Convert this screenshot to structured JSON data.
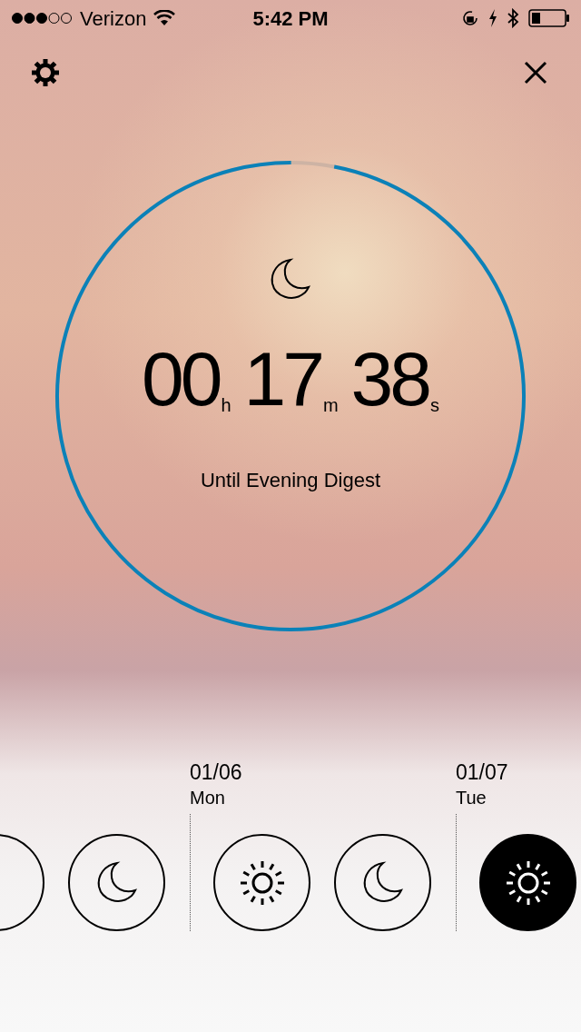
{
  "status_bar": {
    "carrier": "Verizon",
    "time": "5:42 PM"
  },
  "timer": {
    "level": 0.97,
    "countdown": [
      {
        "value": "00",
        "unit": "h"
      },
      {
        "value": "17",
        "unit": "m"
      },
      {
        "value": "38",
        "unit": "s"
      }
    ],
    "caption": "Until Evening Digest"
  },
  "days": [
    {
      "slots": [
        {
          "kind": "blank",
          "selected": false
        },
        {
          "kind": "moon",
          "selected": false
        }
      ]
    },
    {
      "date": "01/06",
      "weekday": "Mon",
      "slots": [
        {
          "kind": "sun",
          "selected": false
        },
        {
          "kind": "moon",
          "selected": false
        }
      ]
    },
    {
      "date": "01/07",
      "weekday": "Tue",
      "slots": [
        {
          "kind": "sun",
          "selected": true
        }
      ]
    }
  ]
}
